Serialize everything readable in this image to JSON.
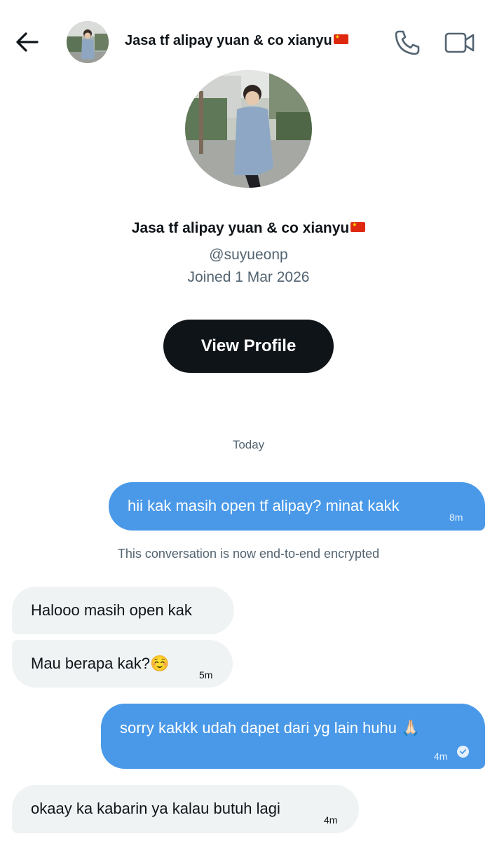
{
  "header": {
    "name": "Jasa tf alipay yuan & co xianyu",
    "flag": "china-flag-icon",
    "icons": [
      "back-arrow-icon",
      "phone-icon",
      "video-camera-icon"
    ]
  },
  "profile": {
    "name": "Jasa tf alipay yuan & co xianyu",
    "handle": "@suyueonp",
    "joined": "Joined 1 Mar 2026",
    "view_profile_label": "View Profile"
  },
  "conversation": {
    "day_label": "Today",
    "system_note": "This conversation is now end-to-end encrypted",
    "messages": [
      {
        "direction": "sent",
        "text": "hii kak masih open tf alipay? minat kakk",
        "time": "8m"
      },
      {
        "direction": "received",
        "text": "Halooo masih open kak",
        "time": ""
      },
      {
        "direction": "received",
        "text": "Mau berapa kak?☺️",
        "time": "5m"
      },
      {
        "direction": "sent",
        "text": "sorry kakkk udah dapet dari yg lain huhu 🙏🏻",
        "time": "4m",
        "status": "read"
      },
      {
        "direction": "received",
        "text": "okaay ka kabarin ya kalau butuh lagi",
        "time": "4m"
      }
    ]
  },
  "colors": {
    "sent_bubble": "#4a99e9",
    "received_bubble": "#eff3f4",
    "primary_text": "#0f1419",
    "secondary_text": "#536471",
    "button_bg": "#0f1419"
  }
}
